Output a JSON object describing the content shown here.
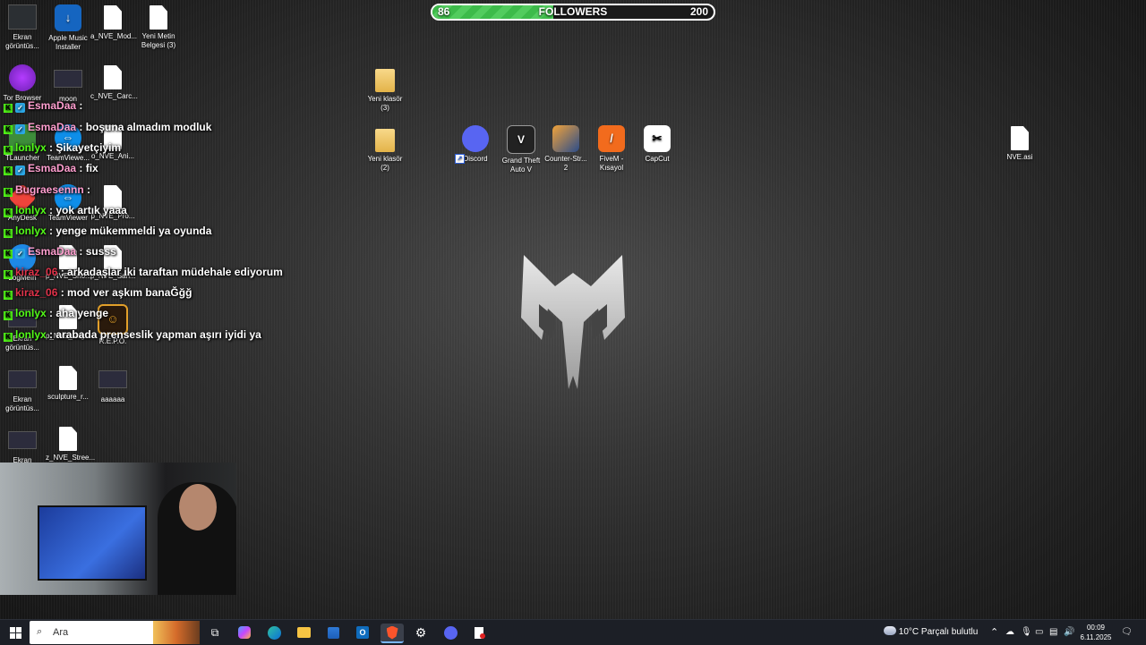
{
  "followers_bar": {
    "current": "86",
    "label": "FOLLOWERS",
    "goal": "200",
    "progress": 0.43
  },
  "desktop_icons": [
    {
      "label": "Ekran görüntüs..."
    },
    {
      "label": "Apple Music Installer"
    },
    {
      "label": "a_NVE_Mod..."
    },
    {
      "label": "Yeni Metin Belgesi (3)"
    },
    {
      "label": "Tor Browser"
    },
    {
      "label": "moon"
    },
    {
      "label": "c_NVE_Carc..."
    },
    {
      "label": "TLauncher"
    },
    {
      "label": "TeamViewe..."
    },
    {
      "label": "o_NVE_Ani..."
    },
    {
      "label": "AnyDesk"
    },
    {
      "label": "TeamViewer"
    },
    {
      "label": "p_NVE_Pro..."
    },
    {
      "label": "LogMeIn"
    },
    {
      "label": "p_NVE_Sno..."
    },
    {
      "label": "p_NVE_San..."
    },
    {
      "label": "Ekran görüntüs..."
    },
    {
      "label": "p_NVE_Veg..."
    },
    {
      "label": "R.E.P.O."
    },
    {
      "label": "Ekran görüntüs..."
    },
    {
      "label": "sculpture_r..."
    },
    {
      "label": "aaaaaa"
    },
    {
      "label": "Ekran"
    },
    {
      "label": "z_NVE_Stree..."
    },
    {
      "label": "Yeni klasör (3)"
    },
    {
      "label": "Yeni klasör (2)"
    },
    {
      "label": "Discord"
    },
    {
      "label": "Grand Theft Auto V"
    },
    {
      "label": "Counter-Str... 2"
    },
    {
      "label": "FiveM - Kısayol"
    },
    {
      "label": "CapCut"
    },
    {
      "label": "NVE.asi"
    }
  ],
  "chat": [
    {
      "user": "EsmaDaa",
      "color": "#ff9ecf",
      "verified": true,
      "message": ""
    },
    {
      "user": "EsmaDaa",
      "color": "#ff9ecf",
      "verified": true,
      "message": "boşuna almadım modluk"
    },
    {
      "user": "lonlyx",
      "color": "#53fc18",
      "verified": false,
      "message": "Şikayetçiyim"
    },
    {
      "user": "EsmaDaa",
      "color": "#ff9ecf",
      "verified": true,
      "message": "fix"
    },
    {
      "user": "Bugraesennn",
      "color": "#ff9ecf",
      "verified": false,
      "message": ""
    },
    {
      "user": "lonlyx",
      "color": "#53fc18",
      "verified": false,
      "message": "yok artık yaaa"
    },
    {
      "user": "lonlyx",
      "color": "#53fc18",
      "verified": false,
      "message": "yenge mükemmeldi ya oyunda"
    },
    {
      "user": "EsmaDaa",
      "color": "#ff9ecf",
      "verified": true,
      "message": "susss"
    },
    {
      "user": "kiraz_06",
      "color": "#e0324a",
      "verified": false,
      "message": "arkadaşlar iki taraftan müdehale ediyorum"
    },
    {
      "user": "kiraz_06",
      "color": "#e0324a",
      "verified": false,
      "message": "mod ver aşkım banaĞğğ"
    },
    {
      "user": "lonlyx",
      "color": "#53fc18",
      "verified": false,
      "message": "aha yenge"
    },
    {
      "user": "lonlyx",
      "color": "#53fc18",
      "verified": false,
      "message": "arabada prenseslik yapman aşırı iyidi ya"
    }
  ],
  "taskbar": {
    "search_placeholder": "Ara",
    "weather": "10°C  Parçalı bulutlu",
    "time": "00:09",
    "date": "6.11.2025"
  }
}
